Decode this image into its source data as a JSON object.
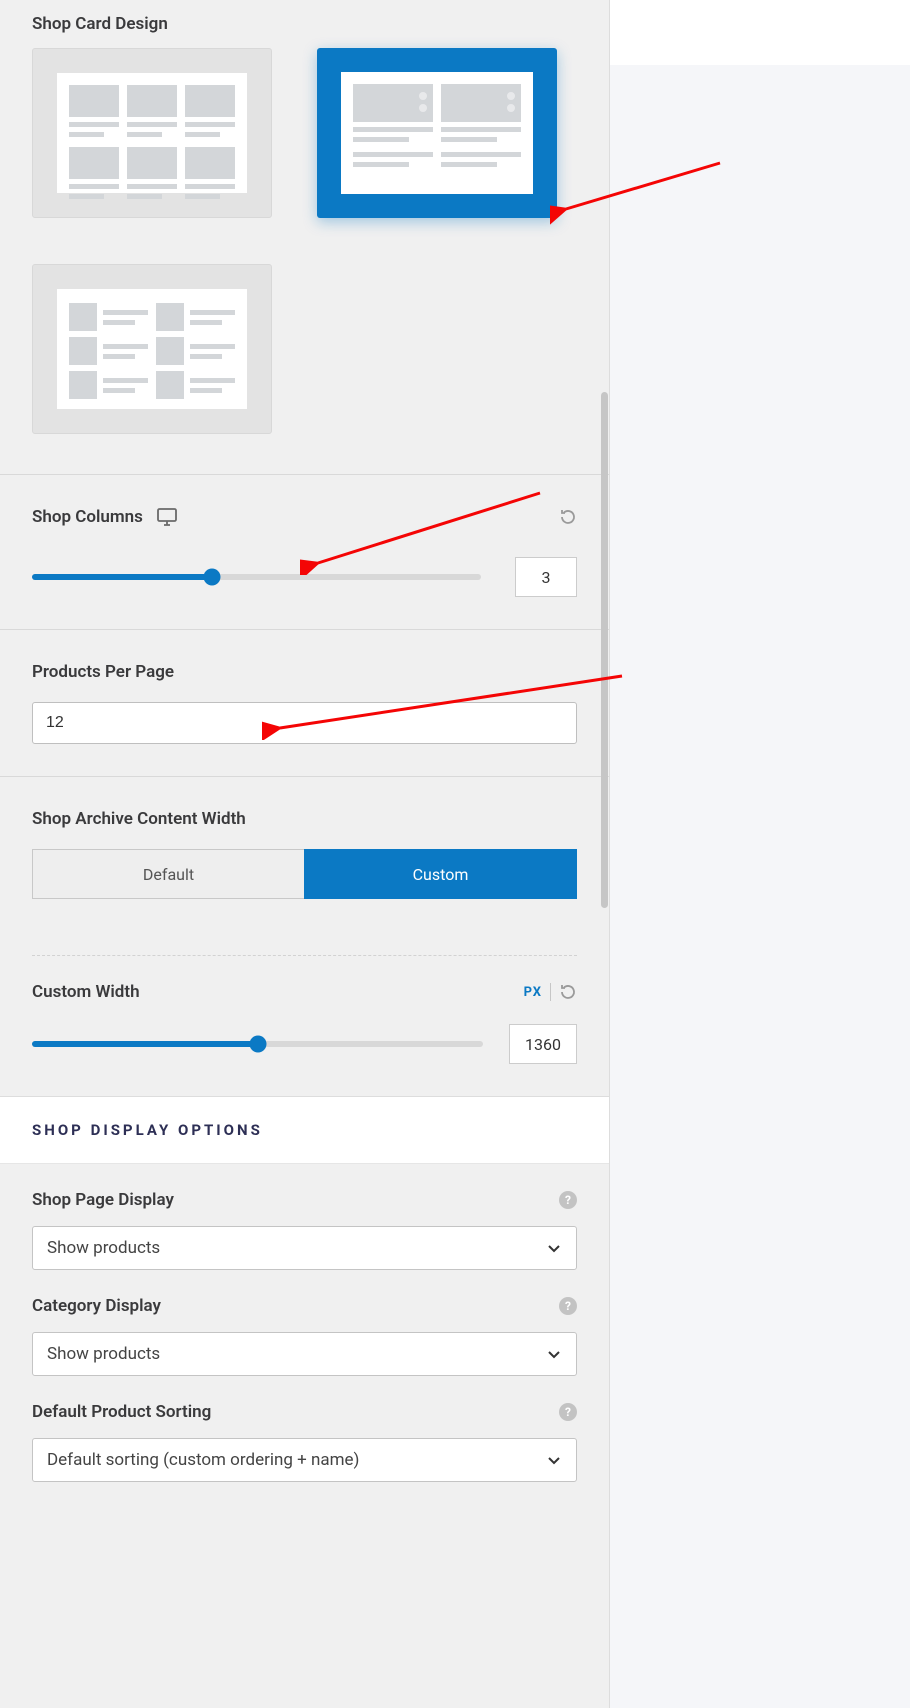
{
  "shop_card_design": {
    "label": "Shop Card Design",
    "selected_index": 1
  },
  "shop_columns": {
    "label": "Shop Columns",
    "value": "3",
    "fill_pct": 40
  },
  "products_per_page": {
    "label": "Products Per Page",
    "value": "12"
  },
  "archive_width": {
    "label": "Shop Archive Content Width",
    "options": {
      "default": "Default",
      "custom": "Custom"
    },
    "selected": "custom"
  },
  "custom_width": {
    "label": "Custom Width",
    "unit": "PX",
    "value": "1360",
    "fill_pct": 50
  },
  "display_options": {
    "heading": "SHOP DISPLAY OPTIONS",
    "shop_page_display": {
      "label": "Shop Page Display",
      "value": "Show products"
    },
    "category_display": {
      "label": "Category Display",
      "value": "Show products"
    },
    "default_sorting": {
      "label": "Default Product Sorting",
      "value": "Default sorting (custom ordering + name)"
    }
  }
}
